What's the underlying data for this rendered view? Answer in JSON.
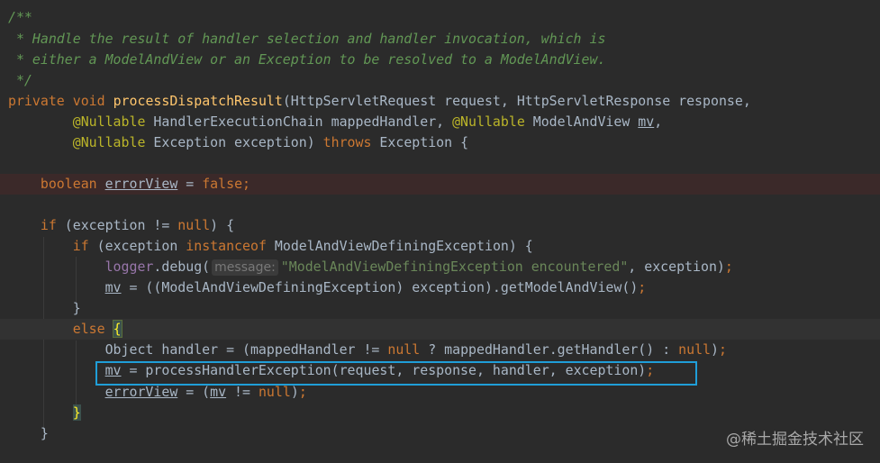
{
  "code_lines": [
    {
      "doc": "/**"
    },
    {
      "doc": " * Handle the result of handler selection and handler invocation, which is"
    },
    {
      "doc": " * either a ModelAndView or an Exception to be resolved to a ModelAndView."
    },
    {
      "doc": " */"
    },
    {
      "kw_private": "private",
      "kw_void": "void",
      "method_name": "processDispatchResult",
      "params": "(HttpServletRequest request, HttpServletResponse response,"
    },
    {
      "ann": "@Nullable",
      "part1": " HandlerExecutionChain mappedHandler, ",
      "ann2": "@Nullable",
      "part2": " ModelAndView ",
      "var_mv": "mv",
      "tail": ","
    },
    {
      "ann": "@Nullable",
      "part1": " Exception exception) ",
      "kw_throws": "throws",
      "tail": " Exception {"
    },
    {
      "kw_boolean": "boolean",
      "var": "errorView",
      "op": " = ",
      "kw_false": "false",
      "semi": ";"
    },
    {
      "kw_if": "if",
      "part1": " (exception != ",
      "kw_null": "null",
      "tail": ") {"
    },
    {
      "kw_if": "if",
      "part1": " (exception ",
      "kw_instanceof": "instanceof",
      "tail": " ModelAndViewDefiningException) {"
    },
    {
      "field": "logger",
      "part1": ".debug(",
      "hint": "message:",
      "string": "\"ModelAndViewDefiningException encountered\"",
      "tail": ", exception)",
      "semi": ";"
    },
    {
      "var_mv": "mv",
      "tail": " = ((ModelAndViewDefiningException) exception).getModelAndView()",
      "semi": ";"
    },
    {
      "brace": "}"
    },
    {
      "kw_else": "else",
      "sp": " ",
      "brace": "{"
    },
    {
      "part1": "Object handler = (mappedHandler != ",
      "kw_null": "null",
      "part2": " ? mappedHandler.getHandler() : ",
      "kw_null2": "null",
      "tail": ")",
      "semi": ";"
    },
    {
      "var_mv": "mv",
      "tail": " = processHandlerException(request, response, handler, exception)",
      "semi": ";"
    },
    {
      "var": "errorView",
      "part1": " = (",
      "var_mv": "mv",
      "part2": " != ",
      "kw_null": "null",
      "tail": ")",
      "semi": ";"
    },
    {
      "brace": "}"
    },
    {
      "brace": "}"
    }
  ],
  "watermark": "@稀土掘金技术社区"
}
